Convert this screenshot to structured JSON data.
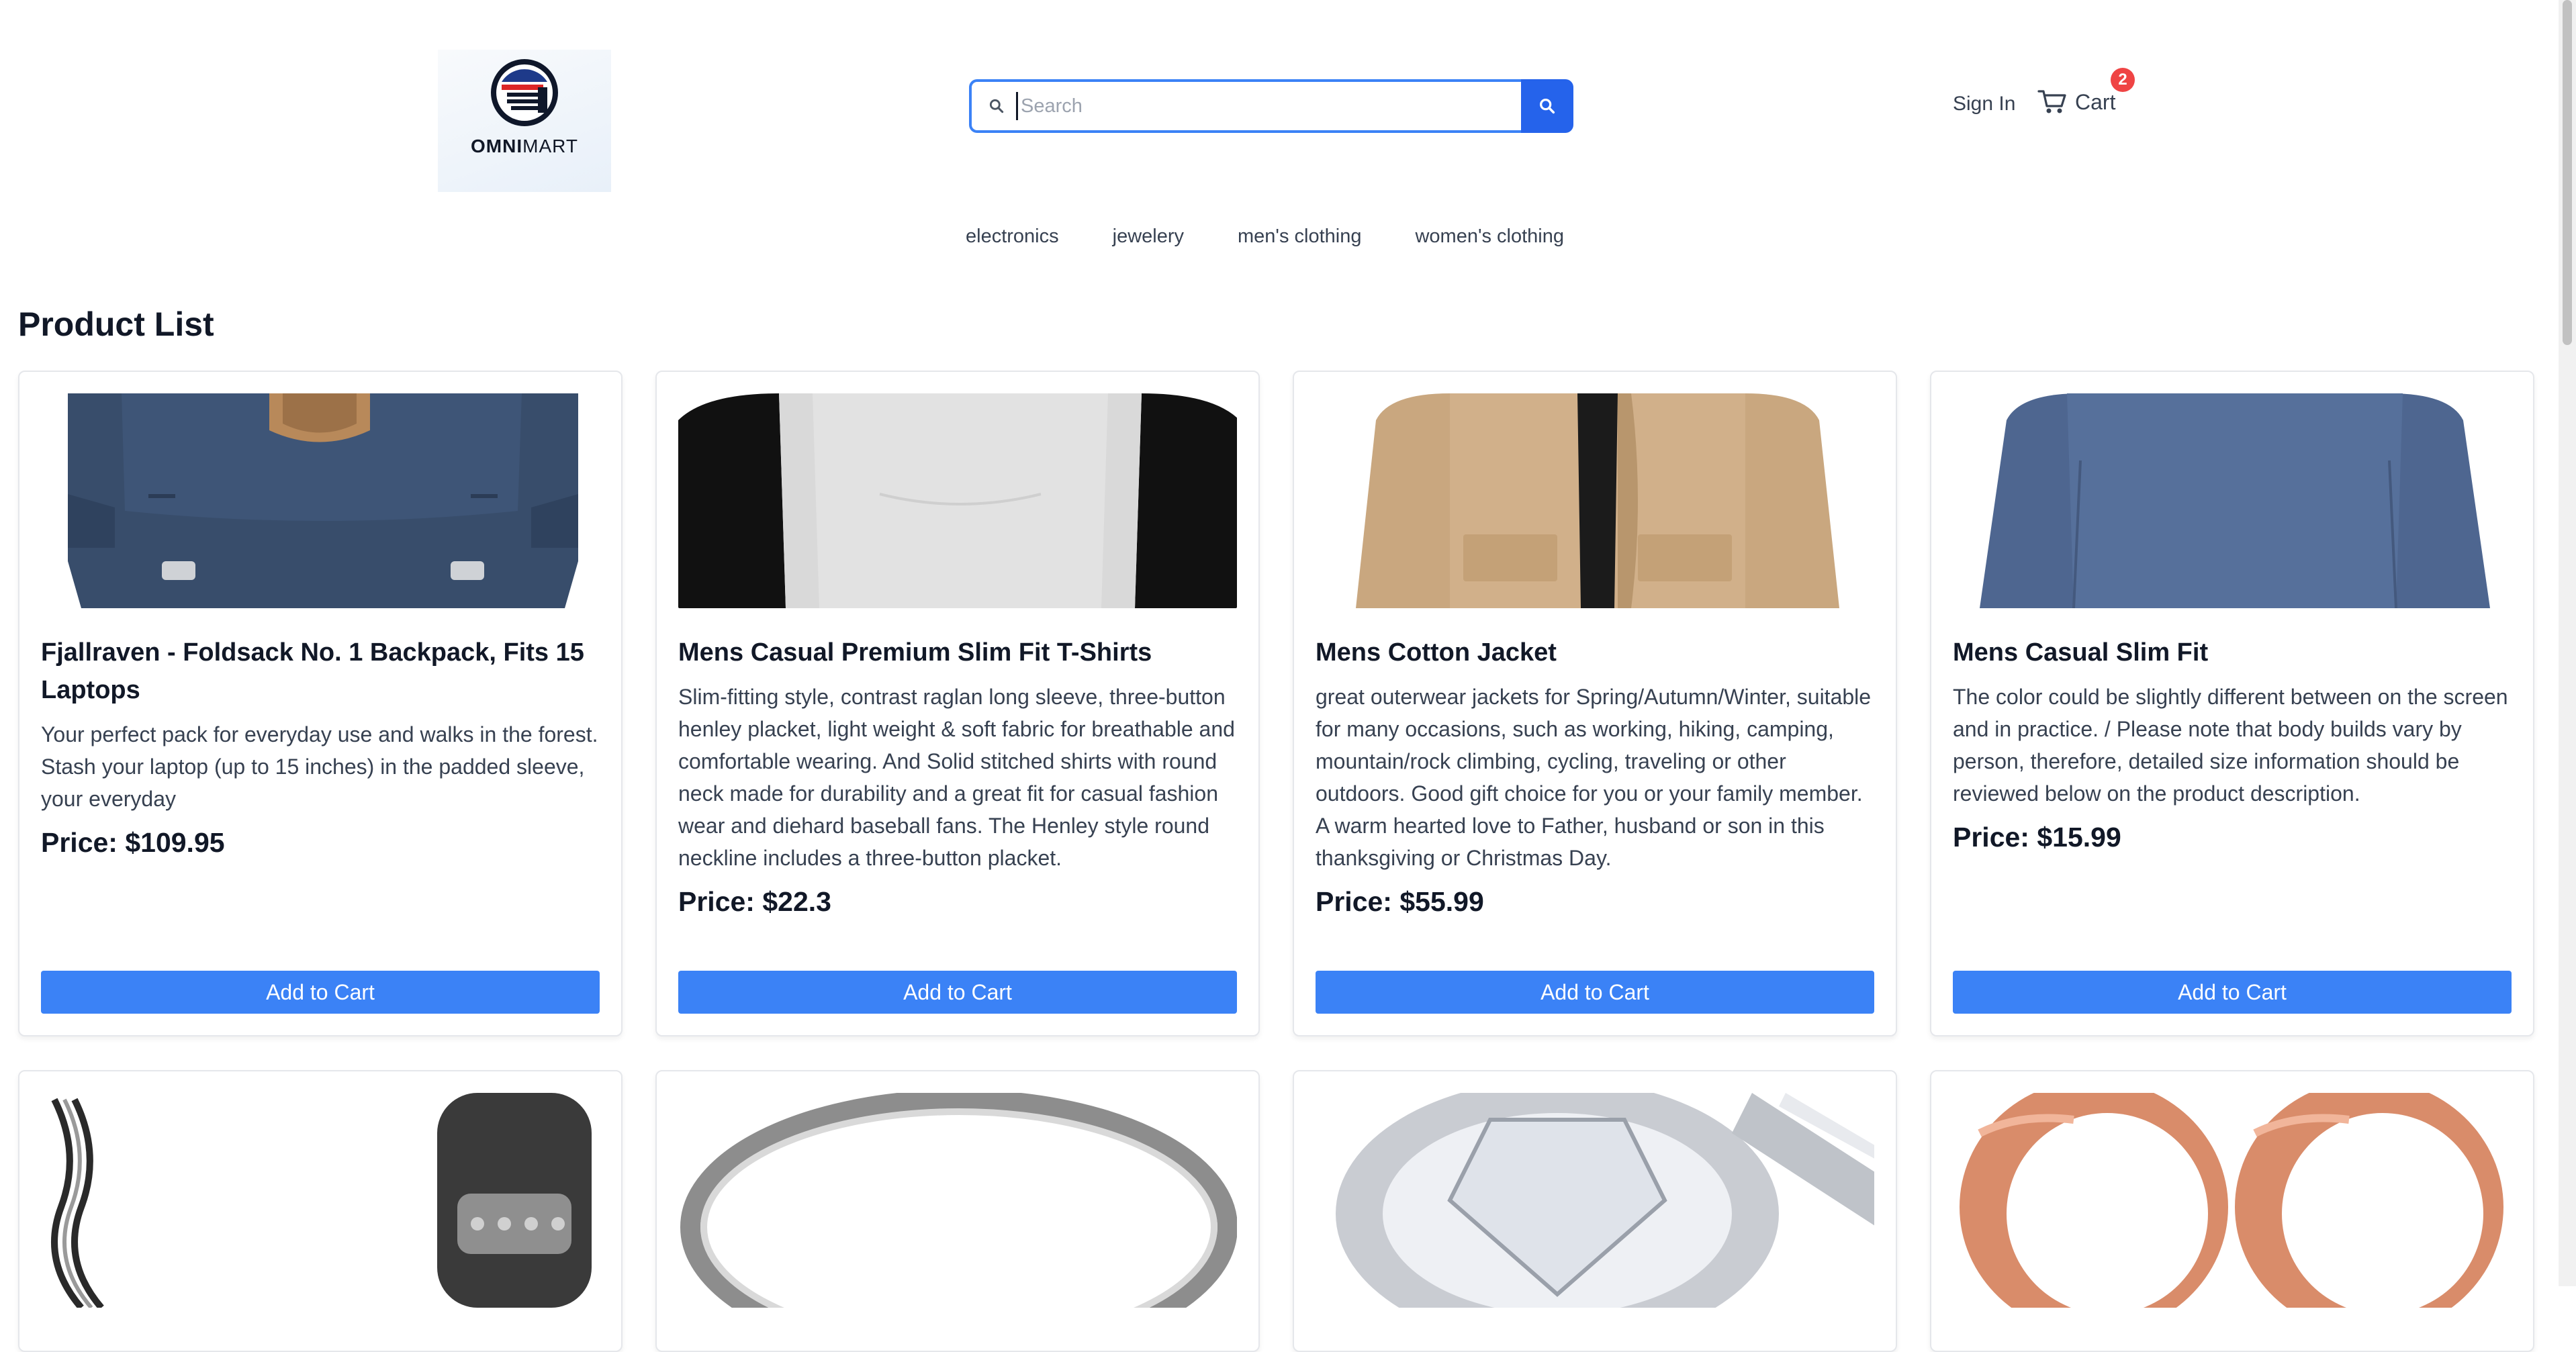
{
  "header": {
    "logo_text_bold": "OMNI",
    "logo_text_regular": "MART",
    "search_placeholder": "Search",
    "search_value": "",
    "signin_label": "Sign In",
    "cart_label": "Cart",
    "cart_count": "2"
  },
  "categories": [
    "electronics",
    "jewelery",
    "men's clothing",
    "women's clothing"
  ],
  "page_title": "Product List",
  "products": [
    {
      "title": "Fjallraven - Foldsack No. 1 Backpack, Fits 15 Laptops",
      "description": "Your perfect pack for everyday use and walks in the forest. Stash your laptop (up to 15 inches) in the padded sleeve, your everyday",
      "price": "Price: $109.95",
      "button": "Add to Cart",
      "image": "backpack"
    },
    {
      "title": "Mens Casual Premium Slim Fit T-Shirts",
      "description": "Slim-fitting style, contrast raglan long sleeve, three-button henley placket, light weight & soft fabric for breathable and comfortable wearing. And Solid stitched shirts with round neck made for durability and a great fit for casual fashion wear and diehard baseball fans. The Henley style round neckline includes a three-button placket.",
      "price": "Price: $22.3",
      "button": "Add to Cart",
      "image": "raglan-tshirt"
    },
    {
      "title": "Mens Cotton Jacket",
      "description": "great outerwear jackets for Spring/Autumn/Winter, suitable for many occasions, such as working, hiking, camping, mountain/rock climbing, cycling, traveling or other outdoors. Good gift choice for you or your family member. A warm hearted love to Father, husband or son in this thanksgiving or Christmas Day.",
      "price": "Price: $55.99",
      "button": "Add to Cart",
      "image": "cotton-jacket"
    },
    {
      "title": "Mens Casual Slim Fit",
      "description": "The color could be slightly different between on the screen and in practice. / Please note that body builds vary by person, therefore, detailed size information should be reviewed below on the product description.",
      "price": "Price: $15.99",
      "button": "Add to Cart",
      "image": "blue-longsleeve"
    },
    {
      "image": "silver-chain-bracelet"
    },
    {
      "image": "silver-ring"
    },
    {
      "image": "diamond-ring"
    },
    {
      "image": "rose-gold-rings"
    }
  ],
  "colors": {
    "accent": "#3b82f6",
    "search_button": "#2563eb",
    "badge": "#ef4444"
  }
}
